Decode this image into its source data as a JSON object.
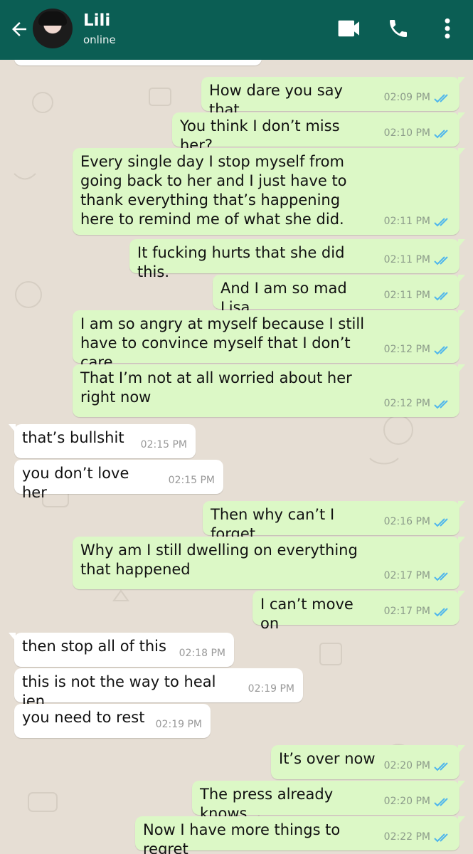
{
  "header": {
    "contact_name": "Lili",
    "status": "online",
    "background": "#0b5e54"
  },
  "messages": [
    {
      "direction": "out",
      "text": "How dare you say that.",
      "time": "02:09 PM"
    },
    {
      "direction": "out",
      "text": "You think I don’t miss her?",
      "time": "02:10 PM"
    },
    {
      "direction": "out",
      "text": "Every single day I stop myself from going back to her and I just have to thank everything that’s happening here to remind me of what she did.",
      "time": "02:11 PM"
    },
    {
      "direction": "out",
      "text": "It fucking hurts that she did this.",
      "time": "02:11 PM"
    },
    {
      "direction": "out",
      "text": "And I am so mad Lisa",
      "time": "02:11 PM"
    },
    {
      "direction": "out",
      "text": "I am so angry at myself because I still have to convince myself that I don’t care",
      "time": "02:12 PM"
    },
    {
      "direction": "out",
      "text": "That I’m not at all worried about her right now",
      "time": "02:12 PM"
    },
    {
      "direction": "in",
      "text": "that’s bullshit",
      "time": "02:15 PM"
    },
    {
      "direction": "in",
      "text": "you don’t love her",
      "time": "02:15 PM"
    },
    {
      "direction": "out",
      "text": "Then why can’t I forget",
      "time": "02:16 PM"
    },
    {
      "direction": "out",
      "text": "Why am I still dwelling on everything that happened",
      "time": "02:17 PM"
    },
    {
      "direction": "out",
      "text": "I can’t move on",
      "time": "02:17 PM"
    },
    {
      "direction": "in",
      "text": "then stop all of this",
      "time": "02:18 PM"
    },
    {
      "direction": "in",
      "text": "this is not the way to heal jen",
      "time": "02:19 PM"
    },
    {
      "direction": "in",
      "text": "you need to rest",
      "time": "02:19 PM"
    },
    {
      "direction": "out",
      "text": "It’s over now",
      "time": "02:20 PM"
    },
    {
      "direction": "out",
      "text": "The press already knows",
      "time": "02:20 PM"
    },
    {
      "direction": "out",
      "text": "Now I have more things to regret",
      "time": "02:22 PM"
    }
  ],
  "colors": {
    "outgoing_bubble": "#dcf8c6",
    "incoming_bubble": "#ffffff",
    "read_ticks": "#4fb6ec",
    "chat_background": "#e6ded4"
  }
}
